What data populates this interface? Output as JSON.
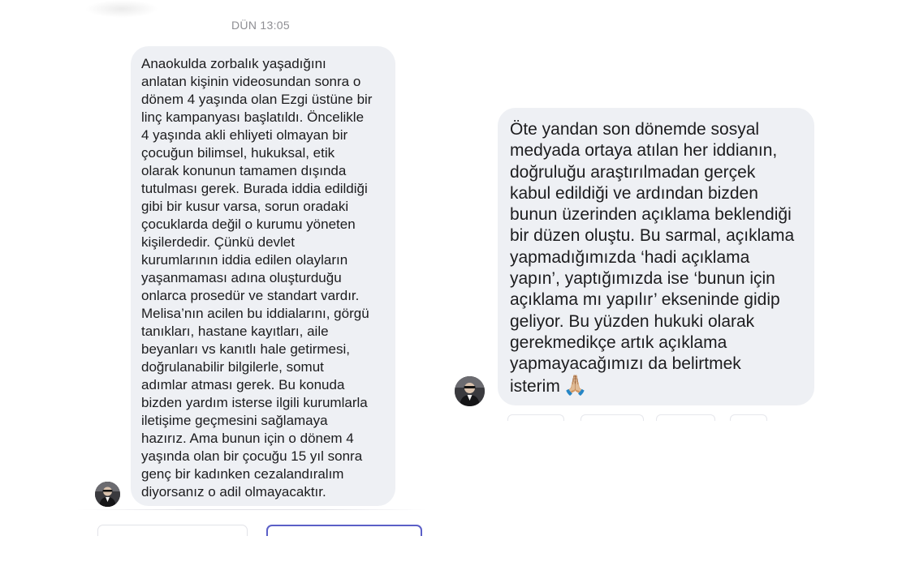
{
  "left_chat": {
    "timestamp": "DÜN 13:05",
    "message": "Anaokulda zorbalık yaşadığını\nanlatan kişinin videosundan sonra o\ndönem 4 yaşında olan Ezgi üstüne bir\nlinç kampanyası başlatıldı. Öncelikle\n4 yaşında akli ehliyeti olmayan bir\nçocuğun bilimsel, hukuksal, etik\nolarak konunun tamamen dışında\ntutulması gerek. Burada iddia edildiği\ngibi bir kusur varsa, sorun oradaki\nçocuklarda değil o kurumu yöneten\nkişilerdedir. Çünkü devlet\nkurumlarının iddia edilen olayların\nyaşanmaması adına oluşturduğu\nonlarca prosedür ve standart vardır.\nMelisa’nın acilen bu iddialarını, görgü\ntanıkları, hastane kayıtları, aile\nbeyanları vs kanıtlı hale getirmesi,\ndoğrulanabilir bilgilerle, somut\nadımlar atması gerek. Bu konuda\nbizden yardım isterse ilgili kurumlarla\niletişime geçmesini sağlamaya\nhazırız. Ama bunun için o dönem 4\nyaşında olan bir çocuğu 15 yıl sonra\ngenç bir kadınken cezalandıralım\ndiyorsanız o adil olmayacaktır."
  },
  "right_chat": {
    "message": "Öte yandan son dönemde sosyal\nmedyada ortaya atılan her iddianın,\ndoğruluğu araştırılmadan gerçek\nkabul edildiği ve ardından bizden\nbunun üzerinden açıklama beklendiği\nbir düzen oluştu. Bu sarmal, açıklama\nyapmadığımızda ‘hadi açıklama\nyapın’, yaptığımızda ise ‘bunun için\naçıklama mı yapılır’ ekseninde gidip\ngeliyor. Bu yüzden hukuki olarak\ngerekmedikçe artık açıklama\nyapmayacağımızı da belirtmek\nisterim",
    "emoji": "🙏🏼"
  },
  "colors": {
    "bubble": "#eef0f4",
    "text": "#1c1c1e",
    "timestamp": "#8e8e93",
    "accent": "#5b5fc7"
  }
}
